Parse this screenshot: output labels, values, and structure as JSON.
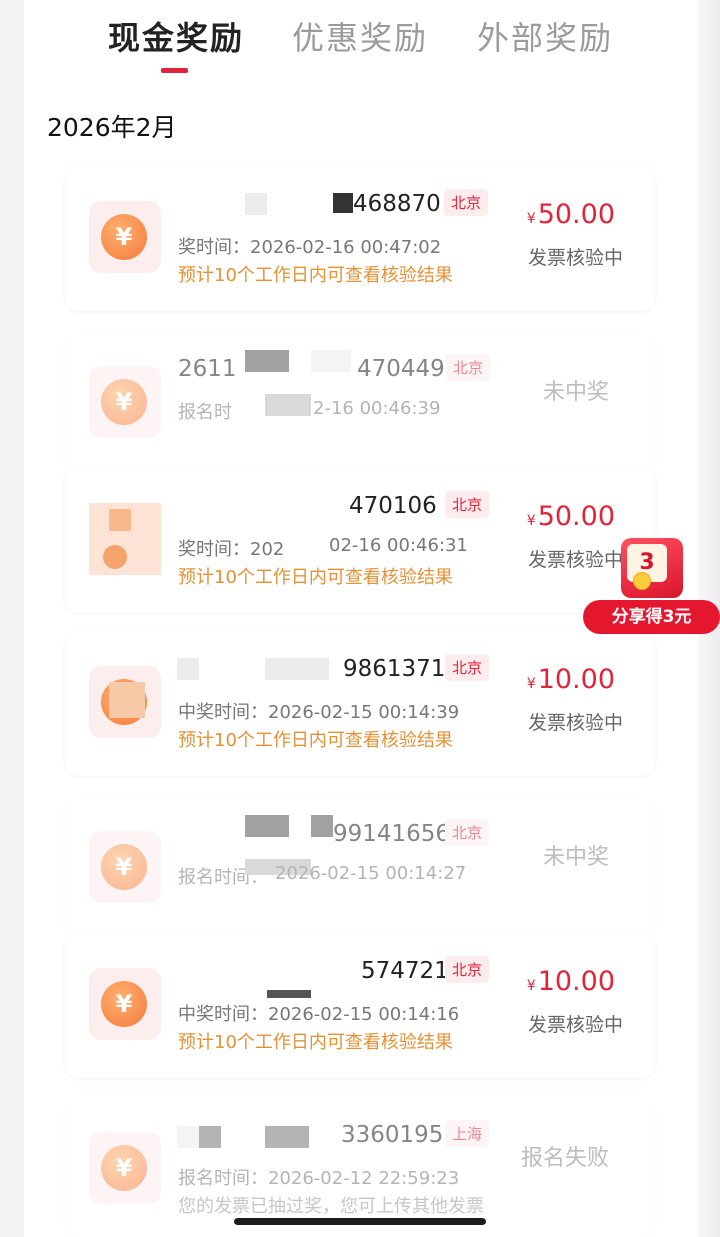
{
  "tabs": [
    {
      "label": "现金奖励",
      "active": true
    },
    {
      "label": "优惠奖励",
      "active": false
    },
    {
      "label": "外部奖励",
      "active": false
    }
  ],
  "month": "2026年2月",
  "records": [
    {
      "invoice_no": "468870",
      "city": "北京",
      "time_text": "奖时间：2026-02-16 00:47:02",
      "note": "预计10个工作日内可查看核验结果",
      "amount": "50.00",
      "status": "发票核验中"
    },
    {
      "invoice_no": "2611",
      "invoice_no2": "470449",
      "city": "北京",
      "time_text": "报名时",
      "time_text2": "2-16 00:46:39",
      "note": "",
      "status": "未中奖"
    },
    {
      "invoice_no": "470106",
      "city": "北京",
      "time_text": "奖时间：202",
      "time_text2": "02-16 00:46:31",
      "note": "预计10个工作日内可查看核验结果",
      "amount": "50.00",
      "status": "发票核验中"
    },
    {
      "invoice_no": "9861371",
      "city": "北京",
      "time_text": "中奖时间：2026-02-15 00:14:39",
      "note": "预计10个工作日内可查看核验结果",
      "amount": "10.00",
      "status": "发票核验中"
    },
    {
      "invoice_no": "99141656",
      "city": "北京",
      "time_text": "报名时间：",
      "time_text2": "2026-02-15 00:14:27",
      "note": "",
      "status": "未中奖"
    },
    {
      "invoice_no": "574721",
      "city": "北京",
      "time_text": "中奖时间：2026-02-15 00:14:16",
      "note": "预计10个工作日内可查看核验结果",
      "amount": "10.00",
      "status": "发票核验中"
    },
    {
      "invoice_no": "3360195",
      "city": "上海",
      "time_text": "报名时间：2026-02-12 22:59:23",
      "note": "您的发票已抽过奖，您可上传其他发票",
      "status": "报名失败"
    }
  ],
  "currency_symbol": "¥",
  "coin_symbol": "¥",
  "promo": {
    "badge_number": "3",
    "label": "分享得3元"
  },
  "colors": {
    "accent": "#e0253b",
    "note": "#e59236"
  }
}
